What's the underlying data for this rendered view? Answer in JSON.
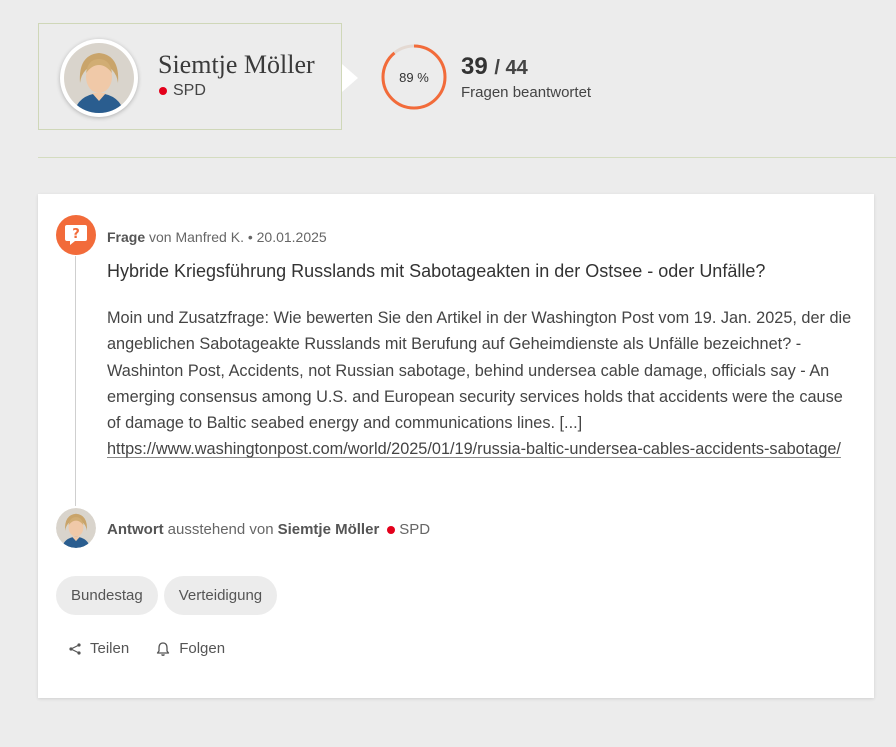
{
  "politician": {
    "name": "Siemtje Möller",
    "party": "SPD",
    "party_color": "#e3001b"
  },
  "stats": {
    "percent_label": "89 %",
    "answered_fraction": 0.89,
    "answered": "39",
    "total": "/ 44",
    "label": "Fragen beantwortet",
    "ring_color": "#f26b3a"
  },
  "question": {
    "icon": "question-bubble-icon",
    "meta_label": "Frage",
    "meta_from": "von Manfred K. • 20.01.2025",
    "title": "Hybride Kriegsführung Russlands mit Sabotageakten in der Ostsee - oder Unfälle?",
    "body_text": "Moin und Zusatzfrage: Wie bewerten Sie den Artikel in der Washington Post vom 19. Jan. 2025, der die angeblichen Sabotageakte Russlands mit Berufung auf Geheimdienste als Un­fälle bezeichnet? - Washinton Post, Accidents, not Russian sabotage, behind undersea cable damage, officials say - An emerging consensus among U.S. and European security services holds that accidents were the cause of damage to Baltic seabed energy and communicati­ons lines. [...] ",
    "body_link": "https://www.washingtonpost.com/world/2025/01/19/russia-baltic-undersea-cables-accidents-sabotage/"
  },
  "answer": {
    "label": "Antwort",
    "status": "ausstehend von",
    "name": "Siemtje Möller",
    "party": "SPD"
  },
  "tags": [
    "Bundestag",
    "Verteidigung"
  ],
  "actions": {
    "share_label": "Teilen",
    "share_icon": "share-icon",
    "follow_label": "Folgen",
    "follow_icon": "bell-icon"
  }
}
